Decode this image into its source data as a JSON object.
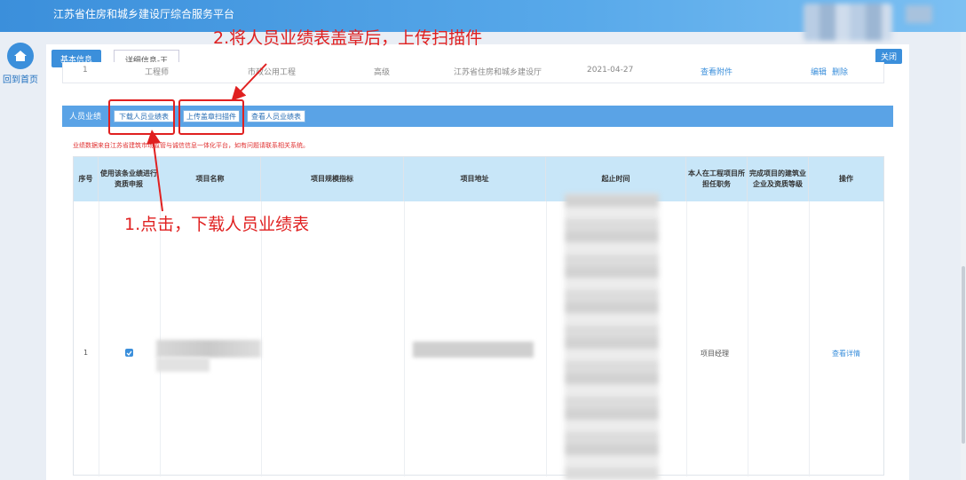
{
  "app": {
    "title": "江苏省住房和城乡建设厅综合服务平台"
  },
  "side": {
    "home_label": "回到首页"
  },
  "tabs": {
    "basic": "基本信息",
    "detail": "详细信息-王"
  },
  "close_label": "关闭",
  "prev_row": [
    "1",
    "工程师",
    "市政公用工程",
    "高级",
    "江苏省住房和城乡建设厅",
    "2021-04-27",
    "查看附件",
    "编辑",
    "删除"
  ],
  "section": {
    "title": "人员业绩",
    "download_btn": "下载人员业绩表",
    "upload_btn": "上传盖章扫描件",
    "view_btn": "查看人员业绩表"
  },
  "notice": "业绩数据来自江苏省建筑市场监管与诚信信息一体化平台，如有问题请联系相关系统。",
  "table": {
    "headers": [
      "序号",
      "使用该条业绩进行资质申报",
      "项目名称",
      "项目规模指标",
      "项目地址",
      "起止时间",
      "本人在工程项目所担任职务",
      "完成项目的建筑业企业及资质等级",
      "操作"
    ],
    "rows": [
      {
        "index": "1",
        "checked": true,
        "role": "项目经理",
        "action": "查看详情"
      }
    ]
  },
  "annotations": {
    "step1": "1.点击，下载人员业绩表",
    "step2": "2.将人员业绩表盖章后，上传扫描件"
  },
  "colors": {
    "accent": "#3b8fdb",
    "annotation": "#e02020"
  }
}
